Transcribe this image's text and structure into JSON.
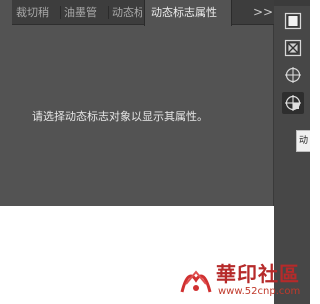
{
  "panel": {
    "tabs": [
      {
        "label": "裁切稍"
      },
      {
        "label": "油墨管"
      },
      {
        "label": "动态标"
      },
      {
        "label": "动态标志属性"
      }
    ],
    "overflow_label": ">>",
    "message": "请选择动态标志对象以显示其属性。"
  },
  "toolbar": {
    "tools": [
      {
        "icon": "page-icon"
      },
      {
        "icon": "crop-mark-icon"
      },
      {
        "icon": "registration-target-icon"
      },
      {
        "icon": "dynamic-mark-icon"
      }
    ],
    "tooltip_label": "动"
  },
  "watermark": {
    "title": "華印社區",
    "url": "www.52cnp.com"
  },
  "colors": {
    "panel_bg": "#535353",
    "tab_bg": "#3d3d3d",
    "strip_bg": "#474747",
    "watermark_red": "#b62a2a"
  }
}
